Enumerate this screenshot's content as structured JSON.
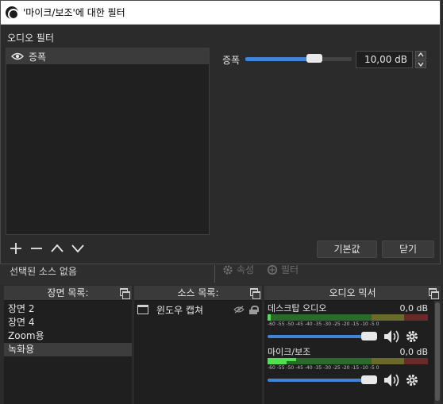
{
  "dialog": {
    "title": "'마이크/보조'에 대한 필터",
    "section_label": "오디오 필터",
    "filters": [
      {
        "label": "증폭",
        "visible": true
      }
    ],
    "property": {
      "label": "증폭",
      "value": "10,00 dB",
      "slider_fraction": 0.65
    },
    "buttons": {
      "defaults": "기본값",
      "close": "닫기"
    },
    "list_buttons": [
      "add-icon",
      "remove-icon",
      "move-up-icon",
      "move-down-icon"
    ]
  },
  "main": {
    "no_source_selected": "선택된 소스 없음",
    "properties_label": "속성",
    "filters_label": "필터",
    "scenes_dock": {
      "title": "장면 목록:",
      "items": [
        "장면 2",
        "장면 4",
        "Zoom용",
        "녹화용"
      ],
      "selected_index": 3
    },
    "sources_dock": {
      "title": "소스 목록:",
      "items": [
        {
          "label": "윈도우 캡쳐",
          "visible": false,
          "locked": true
        }
      ]
    },
    "mixer_dock": {
      "title": "오디오 믹서",
      "ticks": "-60 -55 -50 -45 -40 -35 -30 -25 -20 -15 -10 -5 0",
      "channels": [
        {
          "name": "데스크탑 오디오",
          "level": "0,0 dB",
          "meter_fraction": 0.02,
          "volume_fraction": 1.0
        },
        {
          "name": "마이크/보조",
          "level": "0,0 dB",
          "meter_fraction": 0.6,
          "volume_fraction": 1.0
        }
      ]
    }
  },
  "colors": {
    "accent": "#3f84d8",
    "panel": "#2b2b2b",
    "list": "#202020",
    "meter_green": "#4fe04f"
  }
}
